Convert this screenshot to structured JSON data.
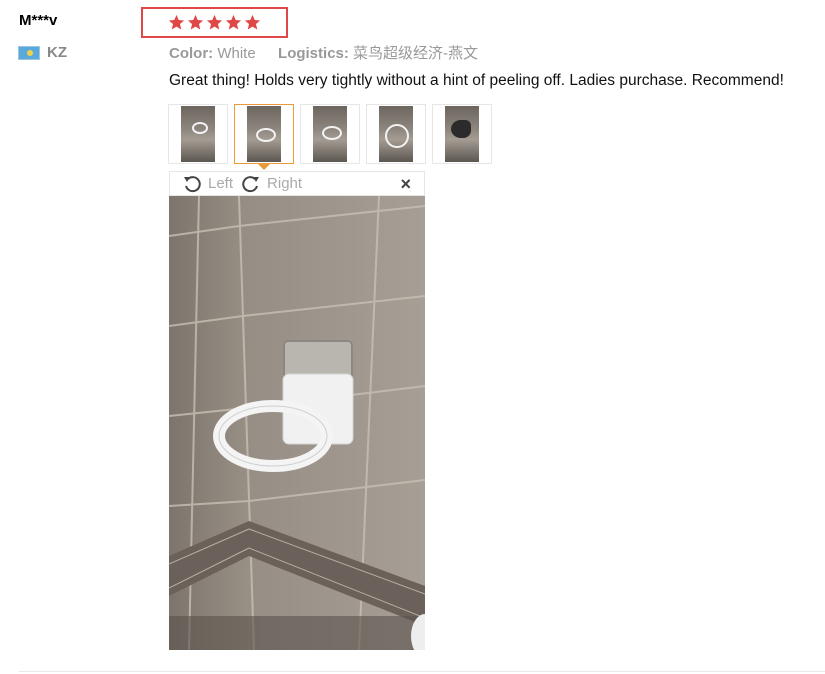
{
  "review": {
    "username": "M***v",
    "country_code": "KZ",
    "flag_icon": "kazakhstan-flag-icon",
    "rating": 5,
    "rating_max": 5,
    "star_color": "#e04848",
    "color_label": "Color:",
    "color_value": "White",
    "logistics_label": "Logistics:",
    "logistics_value": "菜鸟超级经济-燕文",
    "text": "Great thing! Holds very tightly without a hint of peeling off. Ladies purchase. Recommend!"
  },
  "thumbnails": [
    {
      "name": "photo-thumbnail-1",
      "active": false
    },
    {
      "name": "photo-thumbnail-2",
      "active": true
    },
    {
      "name": "photo-thumbnail-3",
      "active": false
    },
    {
      "name": "photo-thumbnail-4",
      "active": false
    },
    {
      "name": "photo-thumbnail-5",
      "active": false
    }
  ],
  "viewer": {
    "rotate_left_label": "Left",
    "rotate_right_label": "Right",
    "close_glyph": "×"
  },
  "colors": {
    "highlight_border": "#e04848",
    "active_thumb_border": "#e89a3c"
  }
}
